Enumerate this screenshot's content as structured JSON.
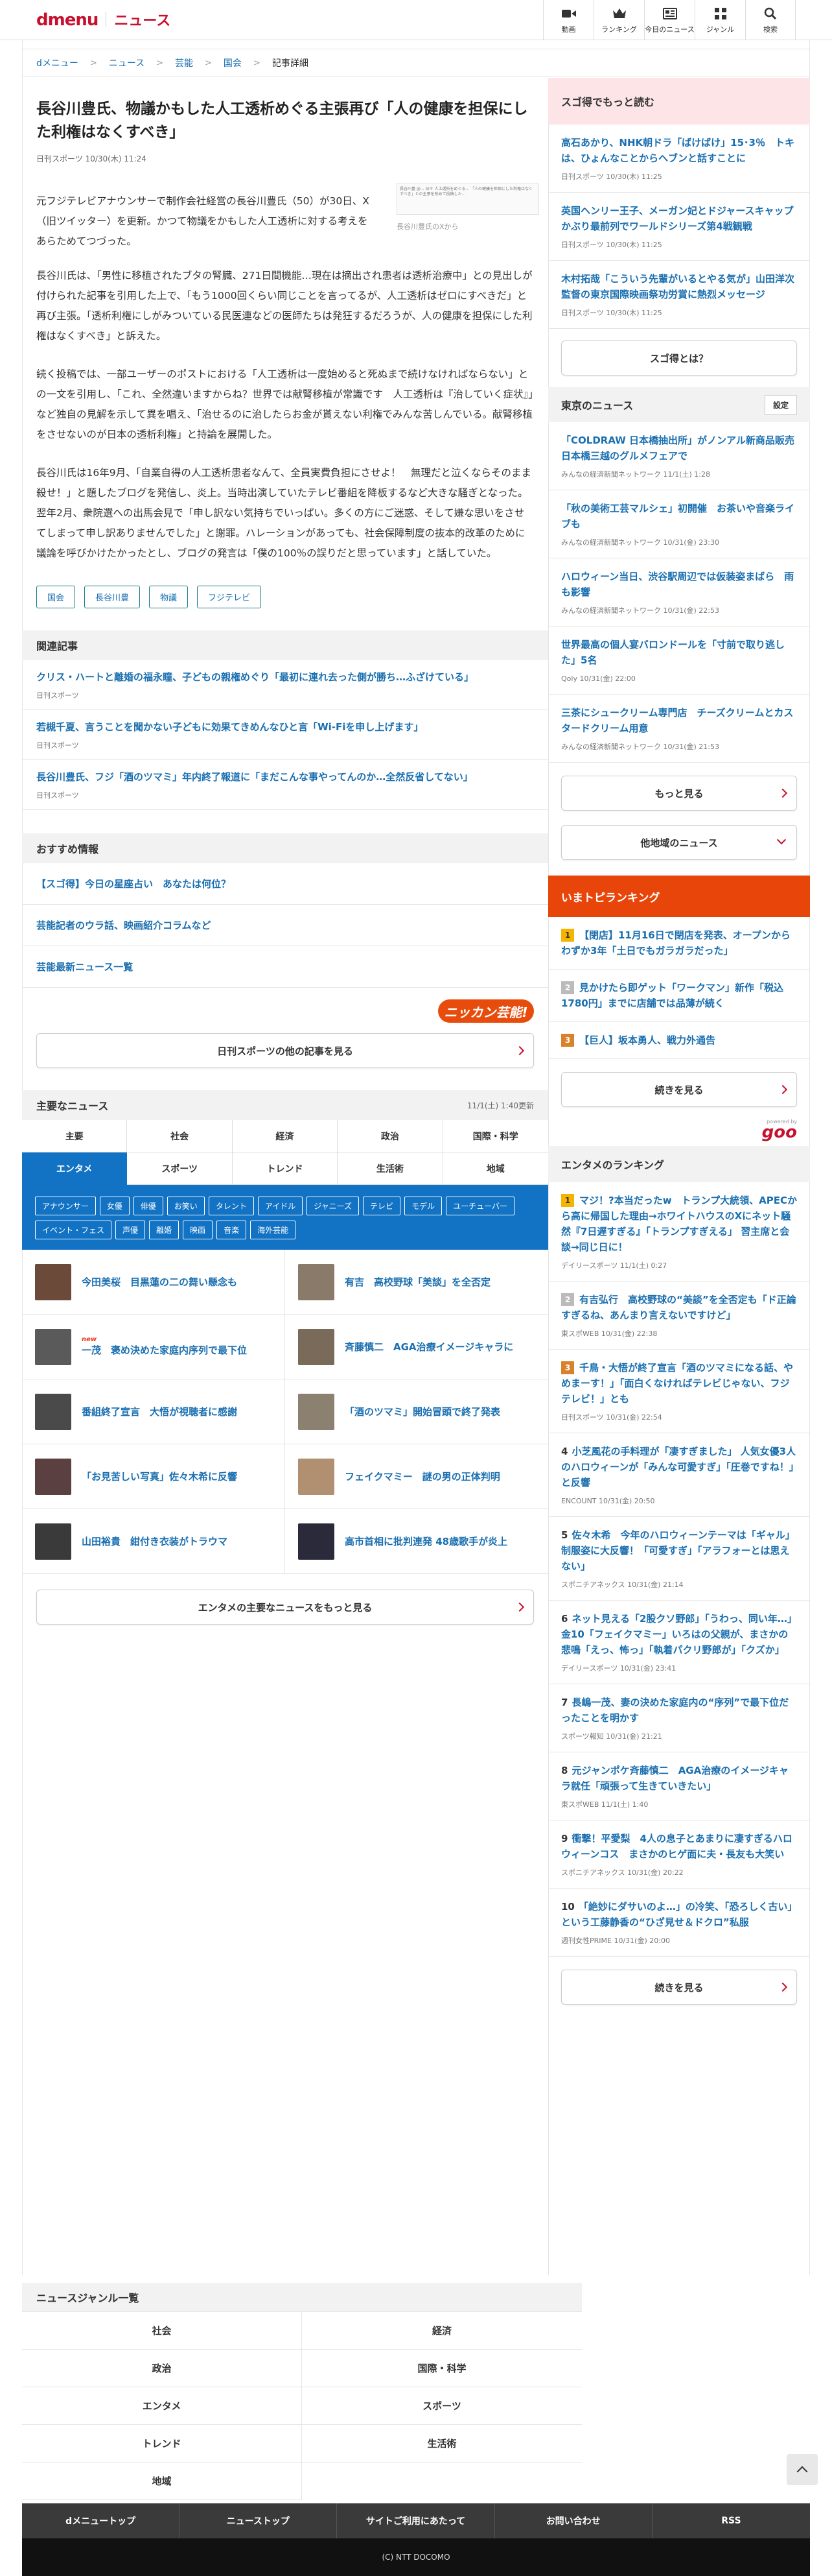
{
  "header": {
    "logo": "dmenu",
    "service": "ニュース",
    "nav": [
      {
        "label": "動画",
        "icon": "video-camera-icon"
      },
      {
        "label": "ランキング",
        "icon": "ranking-crown-icon"
      },
      {
        "label": "今日のニュース",
        "icon": "newspaper-icon"
      },
      {
        "label": "ジャンル",
        "icon": "grid-icon"
      },
      {
        "label": "検索",
        "icon": "search-icon"
      }
    ]
  },
  "breadcrumb": [
    "dメニュー",
    "ニュース",
    "芸能",
    "国会",
    "記事詳細"
  ],
  "article": {
    "title": "長谷川豊氏、物議かもした人工透析めぐる主張再び「人の健康を担保にした利権はなくすべき」",
    "meta": "日刊スポーツ 10/30(木) 11:24",
    "image_caption": "長谷川豊氏のXから",
    "image_text": "長谷川豊 @... 日々 人工透析をめぐる... 「人の健康を担保にした利権はなくすべき」との主張を改めて投稿した...",
    "paragraphs": [
      "元フジテレビアナウンサーで制作会社経営の長谷川豊氏（50）が30日、X（旧ツイッター）を更新。かつて物議をかもした人工透析に対する考えをあらためてつづった。",
      "長谷川氏は、「男性に移植されたブタの腎臓、271日間機能…現在は摘出され患者は透析治療中」との見出しが付けられた記事を引用した上で、「もう1000回くらい同じことを言ってるが、人工透析はゼロにすべきだ」と再び主張。「透析利権にしがみついている民医連などの医師たちは発狂するだろうが、人の健康を担保にした利権はなくすべき」と訴えた。",
      "続く投稿では、一部ユーザーのポストにおける「人工透析は一度始めると死ぬまで続けなければならない」との一文を引用し、「これ、全然違いますからね？世界では献腎移植が常識です　人工透析は『治していく症状』」など独自の見解を示して異を唱え、「治せるのに治したらお金が貰えない利権でみんな苦しんでいる。献腎移植をさせないのが日本の透析利権」と持論を展開した。",
      "長谷川氏は16年9月、「自業自得の人工透析患者なんて、全員実費負担にさせよ！　無理だと泣くならそのまま殺せ！」と題したブログを発信し、炎上。当時出演していたテレビ番組を降板するなど大きな騒ぎとなった。翌年2月、衆院選への出馬会見で「申し訳ない気持ちでいっぱい。多くの方にご迷惑、そして嫌な思いをさせてしまって申し訳ありませんでした」と謝罪。ハレーションがあっても、社会保障制度の抜本的改革のために議論を呼びかけたかったとし、ブログの発言は「僕の100％の誤りだと思っています」と話していた。"
    ],
    "tags": [
      "国会",
      "長谷川豊",
      "物議",
      "フジテレビ"
    ]
  },
  "related": {
    "heading": "関連記事",
    "items": [
      {
        "title": "クリス・ハートと離婚の福永瞳、子どもの親権めぐり「最初に連れ去った側が勝ち…ふざけている」",
        "source": "日刊スポーツ"
      },
      {
        "title": "若槻千夏、言うことを聞かない子どもに効果てきめんなひと言「Wi-Fiを申し上げます」",
        "source": "日刊スポーツ"
      },
      {
        "title": "長谷川豊氏、フジ「酒のツマミ」年内終了報道に「まだこんな事やってんのか…全然反省してない」",
        "source": "日刊スポーツ"
      }
    ]
  },
  "recommend": {
    "heading": "おすすめ情報",
    "items": [
      "【スゴ得】今日の星座占い　あなたは何位？",
      "芸能記者のウラ話、映画紹介コラムなど",
      "芸能最新ニュース一覧"
    ],
    "badge": "ニッカン芸能!",
    "more_button": "日刊スポーツの他の記事を見る"
  },
  "major_news": {
    "heading": "主要なニュース",
    "updated": "11/1(土) 1:40更新",
    "tabs": [
      "主要",
      "社会",
      "経済",
      "政治",
      "国際・科学",
      "エンタメ",
      "スポーツ",
      "トレンド",
      "生活術",
      "地域"
    ],
    "active_tab": "エンタメ",
    "subtags": [
      "アナウンサー",
      "女優",
      "俳優",
      "お笑い",
      "タレント",
      "アイドル",
      "ジャニーズ",
      "テレビ",
      "モデル",
      "ユーチューバー",
      "イベント・フェス",
      "声優",
      "離婚",
      "映画",
      "音楽",
      "海外芸能"
    ],
    "items": [
      {
        "title": "今田美桜　目黒蓮の二の舞い懸念も",
        "new": false,
        "color": "#6b4a3a"
      },
      {
        "title": "有吉　高校野球「美談」を全否定",
        "new": false,
        "color": "#8a7a6a"
      },
      {
        "title": "一茂　褒め決めた家庭内序列で最下位",
        "new": true,
        "color": "#5a5a5a"
      },
      {
        "title": "斉藤慎二　AGA治療イメージキャラに",
        "new": false,
        "color": "#7a6a5a"
      },
      {
        "title": "番組終了宣言　大悟が視聴者に感謝",
        "new": false,
        "color": "#4a4a4a"
      },
      {
        "title": "「酒のツマミ」開始冒頭で終了発表",
        "new": false,
        "color": "#8c8070"
      },
      {
        "title": "「お見苦しい写真」佐々木希に反響",
        "new": false,
        "color": "#5a4040"
      },
      {
        "title": "フェイクマミー　謎の男の正体判明",
        "new": false,
        "color": "#b09070"
      },
      {
        "title": "山田裕貴　紺付き衣装がトラウマ",
        "new": false,
        "color": "#3a3a3a"
      },
      {
        "title": "高市首相に批判連発 48歳歌手が炎上",
        "new": false,
        "color": "#2a2a3a"
      }
    ],
    "more_button": "エンタメの主要なニュースをもっと見る"
  },
  "sidebar": {
    "sugotoku": {
      "heading": "スゴ得でもっと読む",
      "items": [
        {
          "title": "高石あかり、NHK朝ドラ「ばけばけ」15･3％　トキは、ひょんなことからヘブンと話すことに",
          "source": "日刊スポーツ 10/30(木) 11:25"
        },
        {
          "title": "英国ヘンリー王子、メーガン妃とドジャースキャップかぶり最前列でワールドシリーズ第4戦観戦",
          "source": "日刊スポーツ 10/30(木) 11:25"
        },
        {
          "title": "木村拓哉「こういう先輩がいるとやる気が」山田洋次監督の東京国際映画祭功労賞に熱烈メッセージ",
          "source": "日刊スポーツ 10/30(木) 11:25"
        }
      ],
      "button": "スゴ得とは？"
    },
    "tokyo": {
      "heading": "東京のニュース",
      "setting": "設定",
      "items": [
        {
          "title": "「COLDRAW 日本橋抽出所」がノンアル新商品販売　日本橋三越のグルメフェアで",
          "source": "みんなの経済新聞ネットワーク 11/1(土) 1:28"
        },
        {
          "title": "「秋の美術工芸マルシェ」初開催　お茶いや音楽ライブも",
          "source": "みんなの経済新聞ネットワーク 10/31(金) 23:30"
        },
        {
          "title": "ハロウィーン当日、渋谷駅周辺では仮装姿まばら　雨も影響",
          "source": "みんなの経済新聞ネットワーク 10/31(金) 22:53"
        },
        {
          "title": "世界最高の個人宴バロンドールを「寸前で取り逃した」5名",
          "source": "Qoly 10/31(金) 22:00"
        },
        {
          "title": "三茶にシュークリーム専門店　チーズクリームとカスタードクリーム用意",
          "source": "みんなの経済新聞ネットワーク 10/31(金) 21:53"
        }
      ],
      "more": "もっと見る",
      "other": "他地域のニュース"
    },
    "topic": {
      "heading": "いまトピランキング",
      "items": [
        {
          "rank": "1",
          "title": "【閉店】11月16日で閉店を発表、オープンからわずか3年「土日でもガラガラだった」"
        },
        {
          "rank": "2",
          "title": "見かけたら即ゲット「ワークマン」新作「税込1780円」までに店舗では品薄が続く"
        },
        {
          "rank": "3",
          "title": "【巨人】坂本勇人、戦力外通告"
        }
      ],
      "more": "続きを見る",
      "powered": "goo"
    },
    "enta_rank": {
      "heading": "エンタメのランキング",
      "items": [
        {
          "rank": "1",
          "title": "マジ！?本当だったw　トランプ大統領、APECから高に帰国した理由→ホワイトハウスのXにネット騒然『7日遅すぎる』「トランプすぎえる」 習主席と会談→同じ日に！",
          "source": "デイリースポーツ 11/1(土) 0:27"
        },
        {
          "rank": "2",
          "title": "有吉弘行　高校野球の“美談”を全否定も「ド正論すぎるね、あんまり言えないですけど」",
          "source": "東スポWEB 10/31(金) 22:38"
        },
        {
          "rank": "3",
          "title": "千鳥・大悟が終了宣言「酒のツマミになる話、やめまーす！」「面白くなければテレビじゃない、フジテレビ！」とも",
          "source": "日刊スポーツ 10/31(金) 22:54"
        },
        {
          "rank": "4",
          "title": "小芝風花の手料理が「凄すぎました」 人気女優3人のハロウィーンが「みんな可愛すぎ」「圧巻ですね！」と反響",
          "source": "ENCOUNT 10/31(金) 20:50"
        },
        {
          "rank": "5",
          "title": "佐々木希　今年のハロウィーンテーマは「ギャル」制服姿に大反響！「可愛すぎ」「アラフォーとは思えない」",
          "source": "スポニチアネックス 10/31(金) 21:14"
        },
        {
          "rank": "6",
          "title": "ネット見える「2股クソ野郎」「うわっ、同い年…」金10「フェイクマミー」いろはの父親が、まさかの　悲鳴「えっ、怖っ」「執着パクリ野郎が」「クズか」",
          "source": "デイリースポーツ 10/31(金) 23:41"
        },
        {
          "rank": "7",
          "title": "長嶋一茂、妻の決めた家庭内の“序列”で最下位だったことを明かす",
          "source": "スポーツ報知 10/31(金) 21:21"
        },
        {
          "rank": "8",
          "title": "元ジャンポケ斉藤慎二　AGA治療のイメージキャラ就任「頑張って生きていきたい」",
          "source": "東スポWEB 11/1(土) 1:40"
        },
        {
          "rank": "9",
          "title": "衝撃！平愛梨　4人の息子とあまりに凄すぎるハロウィーンコス　まさかのヒゲ面に夫・長友も大笑い",
          "source": "スポニチアネックス 10/31(金) 20:22"
        },
        {
          "rank": "10",
          "title": "「絶妙にダサいのよ…」の冷笑、「恐ろしく古い」という工藤静香の“ひざ見せ＆ドクロ”私服",
          "source": "週刊女性PRIME 10/31(金) 20:00"
        }
      ],
      "more": "続きを見る"
    }
  },
  "genres": {
    "heading": "ニュースジャンル一覧",
    "items": [
      "社会",
      "経済",
      "政治",
      "国際・科学",
      "エンタメ",
      "スポーツ",
      "トレンド",
      "生活術",
      "地域"
    ]
  },
  "footer": {
    "links": [
      "dメニュートップ",
      "ニューストップ",
      "サイトご利用にあたって",
      "お問い合わせ",
      "RSS"
    ],
    "copyright": "(C) NTT DOCOMO"
  }
}
